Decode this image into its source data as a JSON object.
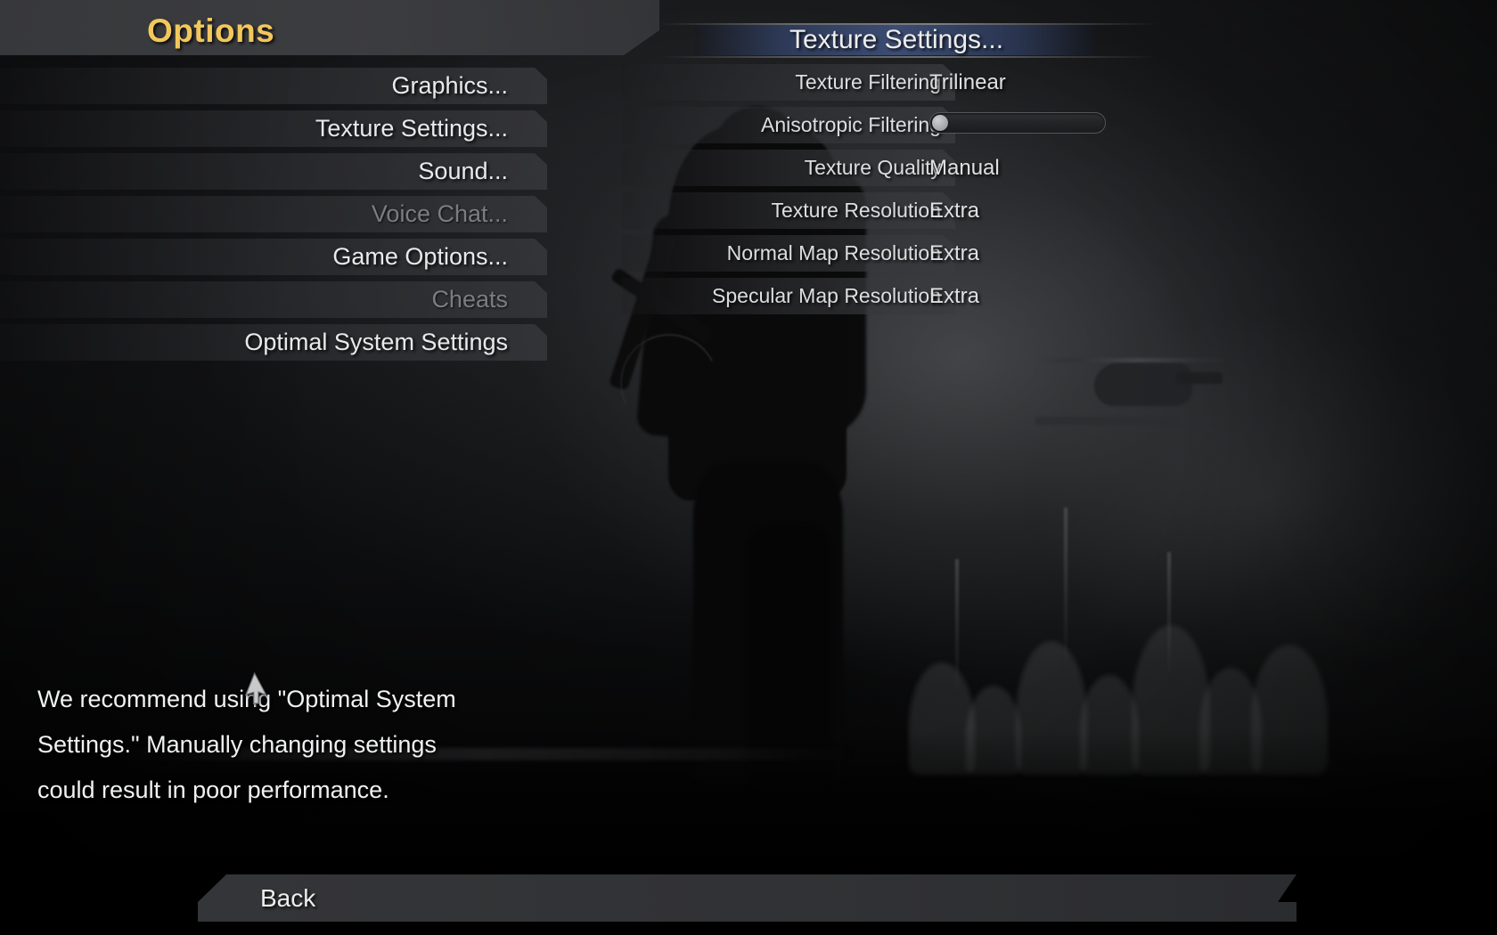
{
  "header": {
    "title": "Options"
  },
  "left_menu": {
    "items": [
      {
        "label": "Graphics...",
        "enabled": true
      },
      {
        "label": "Texture Settings...",
        "enabled": true
      },
      {
        "label": "Sound...",
        "enabled": true
      },
      {
        "label": "Voice Chat...",
        "enabled": false
      },
      {
        "label": "Game Options...",
        "enabled": true
      },
      {
        "label": "Cheats",
        "enabled": false
      },
      {
        "label": "Optimal System Settings",
        "enabled": true
      }
    ]
  },
  "panel": {
    "title": "Texture Settings...",
    "rows": [
      {
        "label": "Texture Filtering",
        "value": "Trilinear",
        "control": "text"
      },
      {
        "label": "Anisotropic Filtering",
        "value": "",
        "control": "slider",
        "slider_percent": 0
      },
      {
        "label": "Texture Quality",
        "value": "Manual",
        "control": "text"
      },
      {
        "label": "Texture Resolution",
        "value": "Extra",
        "control": "text"
      },
      {
        "label": "Normal Map Resolution",
        "value": "Extra",
        "control": "text"
      },
      {
        "label": "Specular Map Resolution",
        "value": "Extra",
        "control": "text"
      }
    ]
  },
  "recommendation": {
    "line1": "We recommend using \"Optimal System",
    "line2": "Settings.\"  Manually changing settings",
    "line3": "could result in poor performance."
  },
  "footer": {
    "back_label": "Back"
  },
  "colors": {
    "title_gold": "#f2c75c",
    "panel_header_blue": "#3e4f77",
    "text_primary": "#eceded",
    "text_disabled": "#7b7d80",
    "bar_gray": "#36373a"
  },
  "cursor": {
    "icon": "arrow-pointer-icon"
  }
}
